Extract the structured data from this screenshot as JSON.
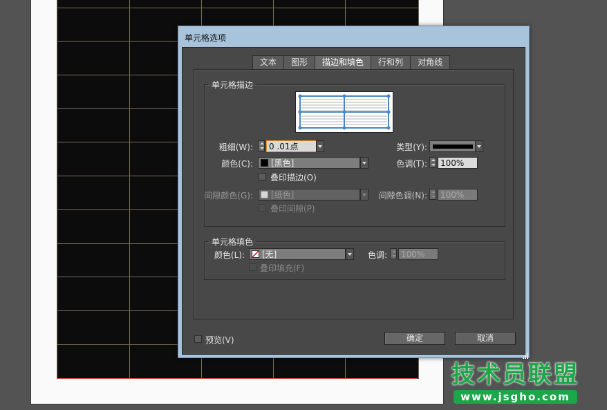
{
  "dialog": {
    "title": "单元格选项",
    "tabs": [
      "文本",
      "图形",
      "描边和填色",
      "行和列",
      "对角线"
    ],
    "active_tab": "描边和填色",
    "stroke_group": {
      "legend": "单元格描边",
      "weight_label": "粗细(W):",
      "weight_value": "0 .01点",
      "type_label": "类型(Y):",
      "color_label": "颜色(C):",
      "color_value": "[黑色]",
      "tint_label": "色调(T):",
      "tint_value": "100%",
      "overprint_stroke": "叠印描边(O)",
      "gap_color_label": "间隙颜色(G):",
      "gap_color_value": "[纸色]",
      "gap_tint_label": "间隙色调(N):",
      "gap_tint_value": "100%",
      "overprint_gap": "叠印间隙(P)"
    },
    "fill_group": {
      "legend": "单元格填色",
      "color_label": "颜色(L):",
      "color_value": "[无]",
      "tint_label": "色调:",
      "tint_value": "100%",
      "overprint_fill": "叠印填充(F)"
    },
    "preview_label": "预览(V)",
    "ok_label": "确定",
    "cancel_label": "取消"
  },
  "watermark": {
    "title": "技术员联盟",
    "url": "www.jsgho.com"
  },
  "colors": {
    "dialog_bg": "#484848",
    "frame": "#a8c3dc",
    "accent_focus": "#e08c2c",
    "watermark_green": "#1ba648"
  }
}
